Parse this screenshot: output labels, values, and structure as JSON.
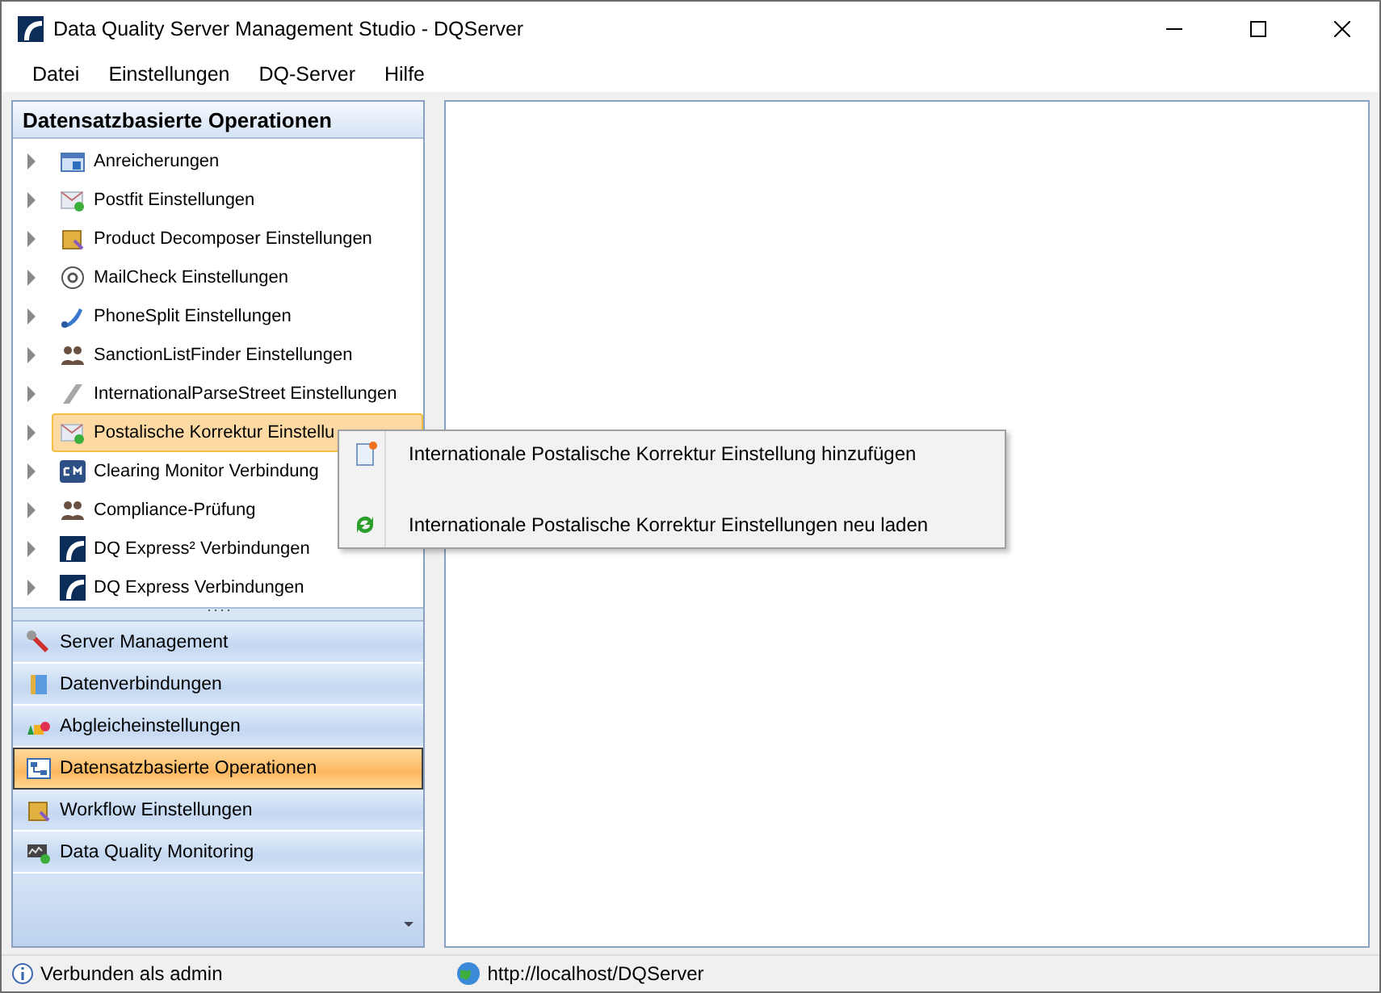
{
  "window": {
    "title": "Data Quality Server Management Studio - DQServer"
  },
  "menu": [
    "Datei",
    "Einstellungen",
    "DQ-Server",
    "Hilfe"
  ],
  "tree": {
    "title": "Datensatzbasierte Operationen",
    "items": [
      {
        "label": "Anreicherungen",
        "expanded": false,
        "selected": false
      },
      {
        "label": "Postfit Einstellungen",
        "expanded": false,
        "selected": false
      },
      {
        "label": "Product Decomposer Einstellungen",
        "expanded": false,
        "selected": false
      },
      {
        "label": "MailCheck Einstellungen",
        "expanded": false,
        "selected": false
      },
      {
        "label": "PhoneSplit Einstellungen",
        "expanded": false,
        "selected": false
      },
      {
        "label": "SanctionListFinder Einstellungen",
        "expanded": false,
        "selected": false
      },
      {
        "label": "InternationalParseStreet Einstellungen",
        "expanded": false,
        "selected": false
      },
      {
        "label": "Postalische Korrektur Einstellu",
        "expanded": false,
        "selected": true
      },
      {
        "label": "Clearing Monitor Verbindung",
        "expanded": false,
        "selected": false
      },
      {
        "label": "Compliance-Prüfung",
        "expanded": false,
        "selected": false
      },
      {
        "label": "DQ Express² Verbindungen",
        "expanded": false,
        "selected": false
      },
      {
        "label": "DQ Express Verbindungen",
        "expanded": false,
        "selected": false
      }
    ]
  },
  "nav": [
    {
      "label": "Server Management",
      "selected": false
    },
    {
      "label": "Datenverbindungen",
      "selected": false
    },
    {
      "label": "Abgleicheinstellungen",
      "selected": false
    },
    {
      "label": "Datensatzbasierte Operationen",
      "selected": true
    },
    {
      "label": "Workflow Einstellungen",
      "selected": false
    },
    {
      "label": "Data Quality Monitoring",
      "selected": false
    }
  ],
  "context_menu": [
    "Internationale Postalische Korrektur Einstellung hinzufügen",
    "Internationale Postalische Korrektur Einstellungen neu laden"
  ],
  "status_bar": {
    "connection": "Verbunden als admin",
    "url": "http://localhost/DQServer"
  }
}
